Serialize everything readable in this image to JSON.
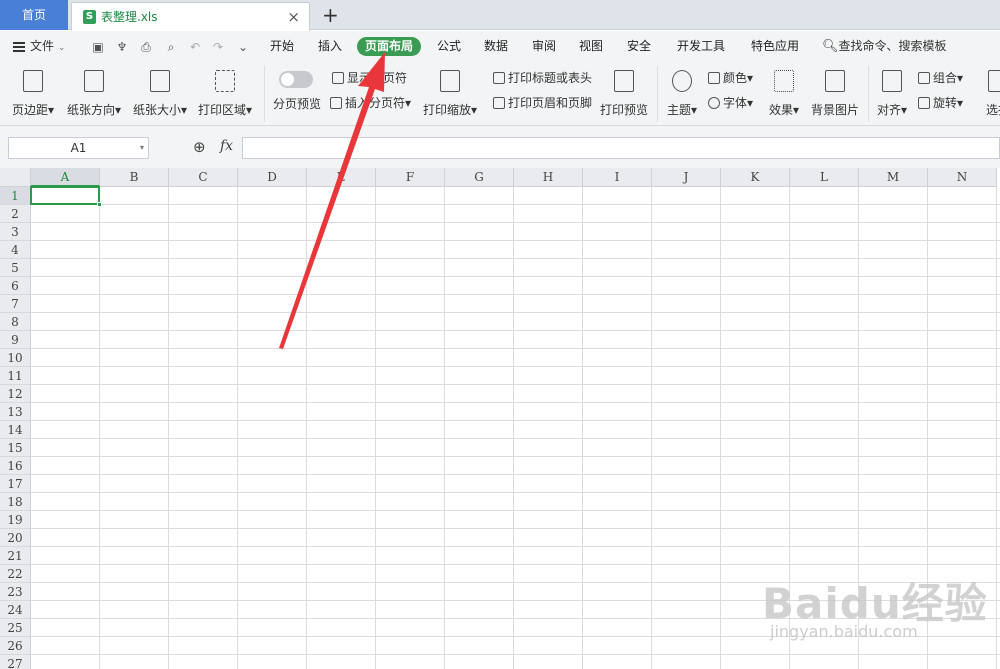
{
  "tabs": {
    "home": "首页",
    "file_name": "表整理.xls",
    "file_icon": "S",
    "close": "×",
    "add": "+"
  },
  "menubar": {
    "file": "文件",
    "items": [
      "开始",
      "插入",
      "页面布局",
      "公式",
      "数据",
      "审阅",
      "视图",
      "安全",
      "开发工具",
      "特色应用"
    ],
    "active": "页面布局",
    "search": "查找命令、搜索模板"
  },
  "ribbon": {
    "margins": "页边距",
    "orientation": "纸张方向",
    "size": "纸张大小",
    "print_area": "打印区域",
    "page_preview": "分页预览",
    "show_breaks": "显示分页符",
    "insert_break": "插入分页符",
    "print_scale": "打印缩放",
    "print_titles": "打印标题或表头",
    "print_header_footer": "打印页眉和页脚",
    "print_preview": "打印预览",
    "theme": "主题",
    "colors": "颜色",
    "fonts": "字体",
    "effects": "效果",
    "background": "背景图片",
    "align": "对齐",
    "group": "组合",
    "rotate": "旋转",
    "select": "选择"
  },
  "formula_bar": {
    "name_box": "A1",
    "fx": "fx",
    "formula": ""
  },
  "grid": {
    "columns": [
      "A",
      "B",
      "C",
      "D",
      "E",
      "F",
      "G",
      "H",
      "I",
      "J",
      "K",
      "L",
      "M",
      "N"
    ],
    "rows": [
      "1",
      "2",
      "3",
      "4",
      "5",
      "6",
      "7",
      "8",
      "9",
      "10",
      "11",
      "12",
      "13",
      "14",
      "15",
      "16",
      "17",
      "18",
      "19",
      "20",
      "21",
      "22",
      "23",
      "24",
      "25",
      "26",
      "27"
    ],
    "selected_cell": "A1"
  },
  "watermark": {
    "brand": "Baidu经验",
    "url": "jingyan.baidu.com"
  },
  "colors": {
    "accent": "#3a9b52",
    "arrow": "#e8363a",
    "home_tab": "#4a7fd6"
  }
}
